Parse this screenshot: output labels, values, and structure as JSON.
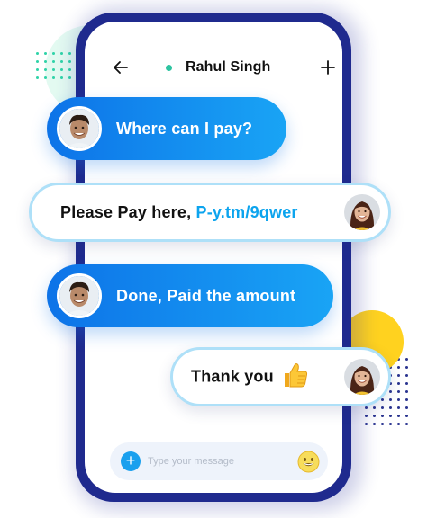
{
  "header": {
    "contact_name": "Rahul Singh",
    "status": "online",
    "back_icon": "arrow-left-icon",
    "add_icon": "plus-icon"
  },
  "messages": [
    {
      "direction": "incoming",
      "sender_avatar": "man-avatar",
      "text": "Where can I pay?"
    },
    {
      "direction": "outgoing",
      "sender_avatar": "woman-avatar",
      "text": "Please Pay here, ",
      "link_text": "P-y.tm/9qwer"
    },
    {
      "direction": "incoming",
      "sender_avatar": "man-avatar",
      "text": "Done, Paid the amount"
    },
    {
      "direction": "outgoing",
      "sender_avatar": "woman-avatar",
      "text": "Thank you",
      "emoji": "thumbs-up-icon"
    }
  ],
  "composer": {
    "placeholder": "Type your message",
    "value": "",
    "add_icon": "plus-circle-icon",
    "emoji_icon": "smiley-icon"
  },
  "colors": {
    "incoming_start": "#0d73e8",
    "incoming_end": "#19a4f5",
    "outgoing_border": "#aee0f8",
    "link": "#0ca4ee",
    "phone_frame": "#1f2a8e",
    "accent_yellow": "#ffd21f",
    "accent_mint": "#e3faf1",
    "status_dot": "#2ec4a1"
  }
}
